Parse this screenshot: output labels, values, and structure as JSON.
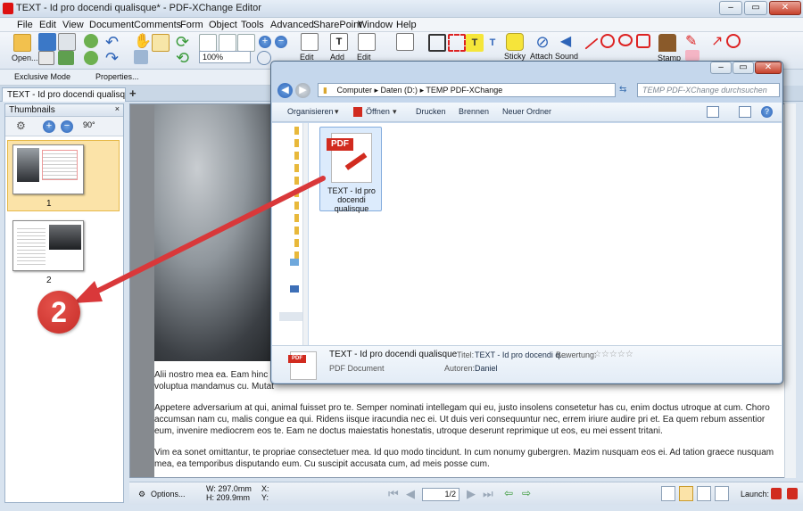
{
  "window": {
    "title": "TEXT - Id pro docendi qualisque* - PDF-XChange Editor"
  },
  "menu": [
    "File",
    "Edit",
    "View",
    "Document",
    "Comments",
    "Form",
    "Object",
    "Tools",
    "Advanced",
    "SharePoint",
    "Window",
    "Help"
  ],
  "toolbar": {
    "open_label": "Open...",
    "zoom_value": "100%",
    "edit_content_label": "Edit\nContent",
    "add_text_label": "Add\nText",
    "edit_form_label": "Edit\nForm",
    "edit_comments_label": "Edit\nComments",
    "sticky_note_label": "Sticky\nNote",
    "attach_file_label": "Attach\nFile",
    "sound_label": "Sound",
    "stamp_label": "Stamp"
  },
  "toolbar2": {
    "exclusive_mode": "Exclusive Mode",
    "properties": "Properties..."
  },
  "tabs": {
    "doc_tab": "TEXT - Id pro docendi qualisque *",
    "new_tab": "+"
  },
  "thumbnails": {
    "header": "Thumbnails",
    "pages": [
      "1",
      "2"
    ]
  },
  "document": {
    "paragraphs": [
      "Alii nostro mea ea. Eam hinc pri",
      "voluptua mandamus cu. Mutat",
      "Appetere adversarium at qui, animal fuisset pro te. Semper nominati intellegam qui eu, justo insolens consetetur has cu, enim doctus utroque at cum. Choro accumsan nam cu, malis congue ea qui. Ridens iisque iracundia nec ei. Ut duis veri consequuntur nec, errem iriure audire pri et. Ea quem rebum assentior eum, invenire mediocrem eos te. Eam ne doctus maiestatis honestatis, utroque deserunt reprimique ut eos, eu mei essent tritani.",
      "Vim ea sonet omittantur, te propriae consectetuer mea. Id quo modo tincidunt. In cum nonumy gubergren. Mazim nusquam eos ei. Ad tation graece nusquam mea, ea temporibus disputando eum. Cu suscipit accusata cum, ad meis posse cum."
    ]
  },
  "statusbar": {
    "options": "Options...",
    "width": "W: 297.0mm",
    "height": "H: 209.9mm",
    "x": "X:",
    "y": "Y:",
    "page_value": "1/2",
    "launch": "Launch:"
  },
  "explorer": {
    "address": [
      "Computer",
      "Daten (D:)",
      "TEMP PDF-XChange"
    ],
    "search_placeholder": "TEMP PDF-XChange durchsuchen",
    "commands": [
      "Organisieren",
      "Öffnen",
      "Drucken",
      "Brennen",
      "Neuer Ordner"
    ],
    "file": {
      "badge": "PDF",
      "name": "TEXT - Id pro docendi qualisque"
    },
    "details": {
      "name": "TEXT - Id pro docendi qualisque",
      "type": "PDF Document",
      "title_label": "Titel:",
      "title_value": "TEXT - Id pro docendi q...",
      "rating_label": "Bewertung:",
      "stars": "☆☆☆☆☆",
      "authors_label": "Autoren:",
      "authors_value": "Daniel"
    }
  },
  "annotation": {
    "step_number": "2",
    "color": "#d9383a"
  }
}
